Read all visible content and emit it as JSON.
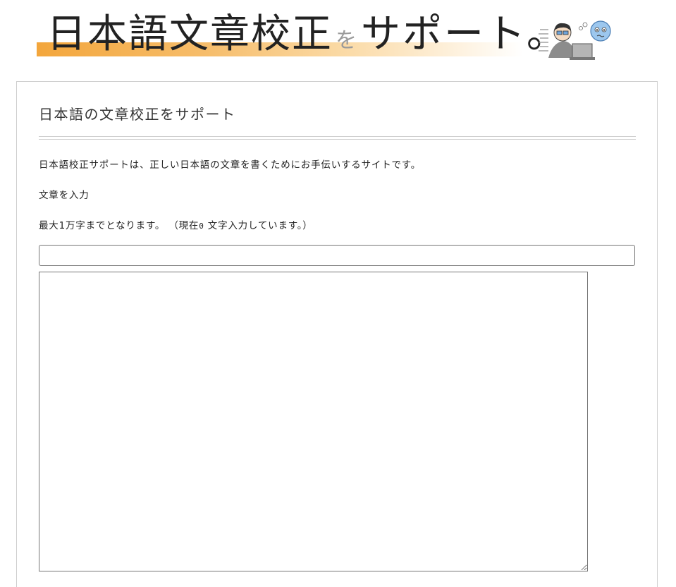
{
  "banner": {
    "title_main": "日本語文章校正",
    "title_particle": "を",
    "title_rest": "サポート。"
  },
  "card": {
    "title": "日本語の文章校正をサポート",
    "intro": "日本語校正サポートは、正しい日本語の文章を書くためにお手伝いするサイトです。",
    "input_label": "文章を入力",
    "limit_before": "最大1万字までとなります。 （現在",
    "char_count": "0",
    "limit_after": "文字入力しています。）",
    "text_input_value": "",
    "textarea_value": ""
  },
  "colors": {
    "banner_accent": "#f3a63c",
    "card_border": "#cfcfcf"
  }
}
